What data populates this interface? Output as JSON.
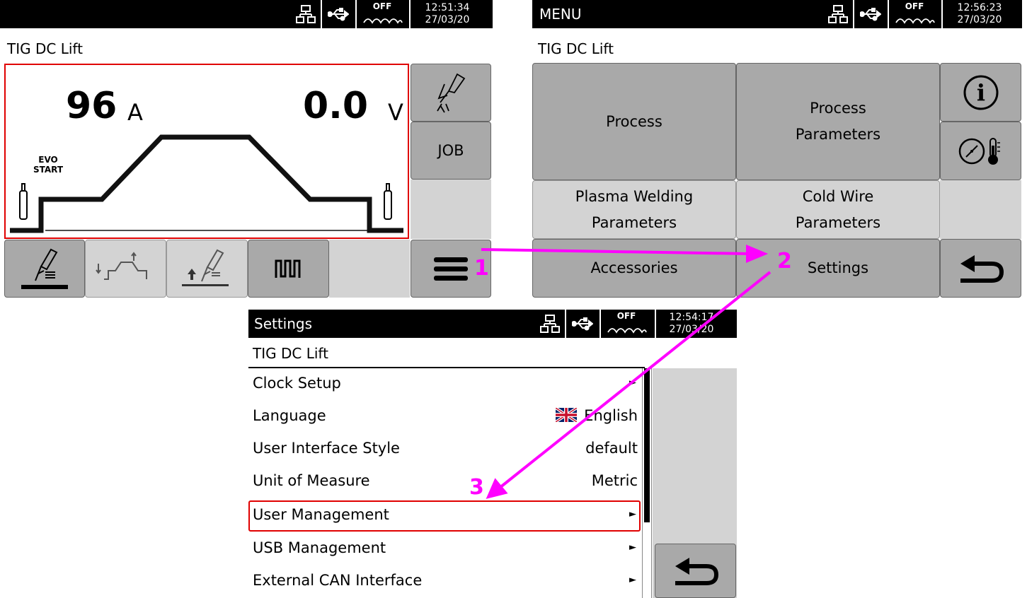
{
  "screen_main": {
    "status": {
      "off_label": "OFF",
      "time": "12:51:34",
      "date": "27/03/20"
    },
    "mode": "TIG  DC  Lift",
    "current_value": "96",
    "current_unit": "A",
    "voltage_value": "0.0",
    "voltage_unit": "V",
    "evo_line1": "EVO",
    "evo_line2": "START",
    "job_label": "JOB",
    "callout": "1",
    "icons": [
      "torch-trigger-icon",
      "job-icon",
      "electrode-icon",
      "current-slope-icon",
      "torch-up-icon",
      "pulse-icon",
      "menu-icon"
    ]
  },
  "screen_menu": {
    "status": {
      "title": "MENU",
      "off_label": "OFF",
      "time": "12:56:23",
      "date": "27/03/20"
    },
    "mode": "TIG  DC  Lift",
    "process": "Process",
    "process_params_1": "Process",
    "process_params_2": "Parameters",
    "plasma_1": "Plasma Welding",
    "plasma_2": "Parameters",
    "cold_wire_1": "Cold Wire",
    "cold_wire_2": "Parameters",
    "accessories": "Accessories",
    "settings": "Settings",
    "info_glyph": "i",
    "callout": "2",
    "icons": [
      "info-icon",
      "gauge-thermometer-icon",
      "back-icon"
    ]
  },
  "screen_settings": {
    "status": {
      "title": "Settings",
      "off_label": "OFF",
      "time": "12:54:17",
      "date": "27/03/20"
    },
    "mode": "TIG  DC  Lift",
    "rows": [
      {
        "label": "Clock Setup",
        "value": "",
        "arrow": "►"
      },
      {
        "label": "Language",
        "value": "English",
        "arrow": ""
      },
      {
        "label": "User Interface Style",
        "value": "default",
        "arrow": ""
      },
      {
        "label": "Unit of Measure",
        "value": "Metric",
        "arrow": ""
      },
      {
        "label": "User Management",
        "value": "",
        "arrow": "►"
      },
      {
        "label": "USB Management",
        "value": "",
        "arrow": "►"
      },
      {
        "label": "External CAN Interface",
        "value": "",
        "arrow": "►"
      }
    ],
    "callout": "3",
    "icons": [
      "uk-flag-icon",
      "back-icon"
    ]
  },
  "colors": {
    "highlight": "#e00000",
    "annotation": "#ff00ff",
    "button": "#a9a9a9",
    "button_light": "#d3d3d3"
  }
}
